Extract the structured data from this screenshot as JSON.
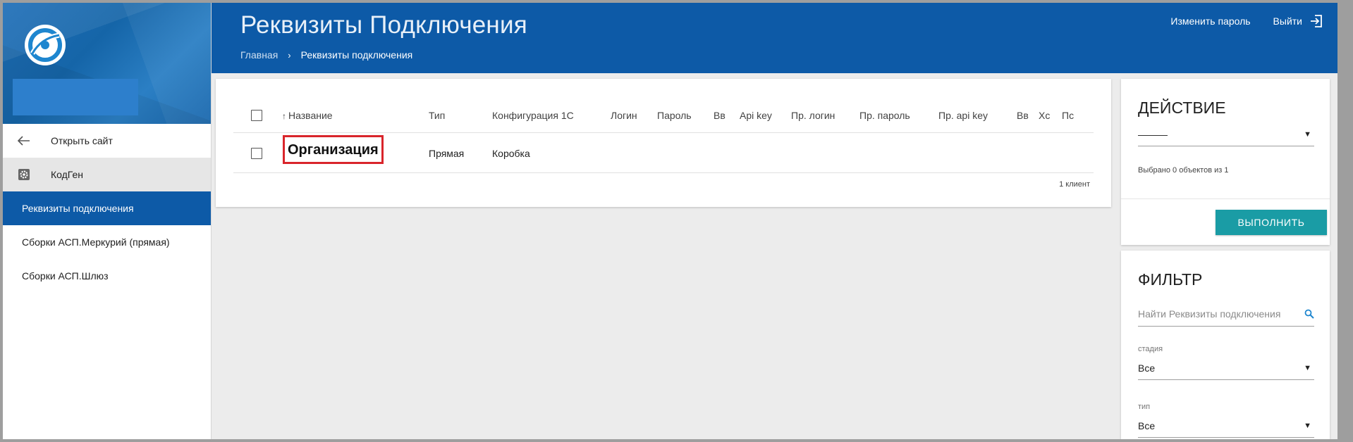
{
  "app": {
    "page_title": "Реквизиты Подключения",
    "breadcrumb": {
      "home": "Главная",
      "separator": "›",
      "current": "Реквизиты подключения"
    },
    "top_actions": {
      "change_password": "Изменить пароль",
      "logout": "Выйти"
    }
  },
  "colors": {
    "primary": "#0d5aa7",
    "accent_button": "#1a9ca5",
    "highlight_border": "#d9252b"
  },
  "sidebar": {
    "items": [
      {
        "label": "Открыть сайт",
        "icon": "arrow-left-icon"
      },
      {
        "label": "КодГен",
        "icon": "gear-icon"
      },
      {
        "label": "Реквизиты подключения",
        "active": true
      },
      {
        "label": "Сборки АСП.Меркурий (прямая)"
      },
      {
        "label": "Сборки АСП.Шлюз"
      }
    ]
  },
  "table": {
    "columns": [
      "Название",
      "Тип",
      "Конфигурация 1С",
      "Логин",
      "Пароль",
      "Вв",
      "Api key",
      "Пр. логин",
      "Пр. пароль",
      "Пр. api key",
      "Вв",
      "Хс",
      "Пс"
    ],
    "sort_icon": "arrow-up-icon",
    "rows": [
      {
        "name": "Организация",
        "type": "Прямая",
        "config": "Коробка"
      }
    ],
    "count_text": "1 клиент"
  },
  "action_panel": {
    "title": "ДЕЙСТВИЕ",
    "selected_value": "———",
    "selection_info": "Выбрано 0 объектов из 1",
    "run_button": "ВЫПОЛНИТЬ"
  },
  "filter_panel": {
    "title": "ФИЛЬТР",
    "search_placeholder": "Найти Реквизиты подключения",
    "stage_label": "стадия",
    "stage_value": "Все",
    "type_label": "тип",
    "type_value": "Все"
  }
}
